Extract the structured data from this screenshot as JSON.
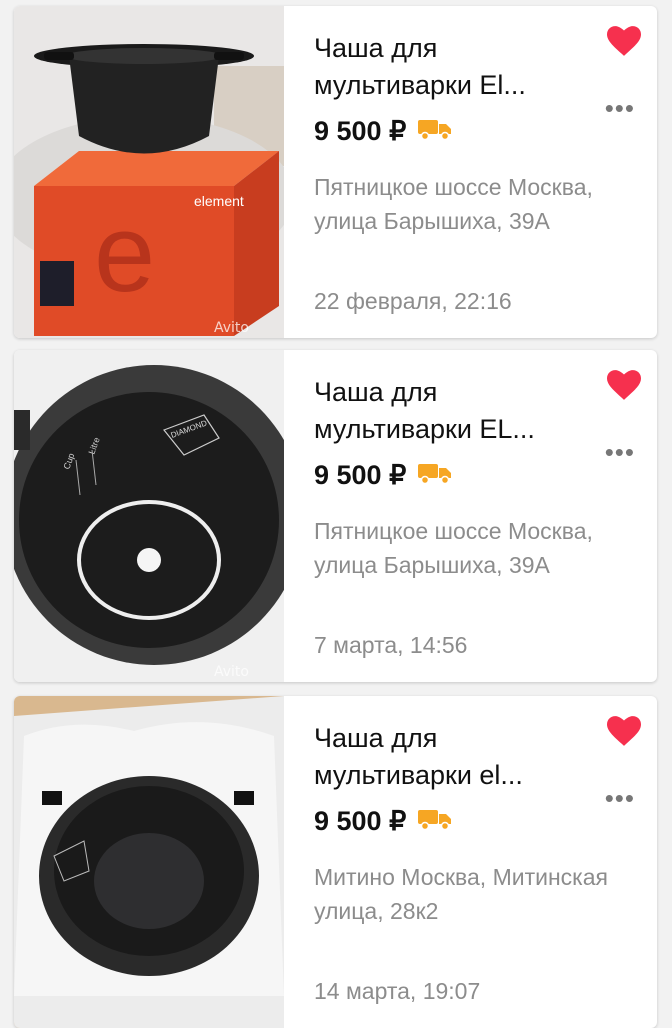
{
  "listings": [
    {
      "title": "Чаша для мультиварки El...",
      "price": "9 500 ₽",
      "address": "Пятницкое шоссе Москва, улица Барышиха, 39А",
      "date": "22 февраля, 22:16",
      "favorited": true,
      "watermark": "Avito",
      "box_label": "element"
    },
    {
      "title": "Чаша для мультиварки EL...",
      "price": "9 500 ₽",
      "address": "Пятницкое шоссе Москва, улица Барышиха, 39А",
      "date": "7 марта, 14:56",
      "favorited": true,
      "watermark": "Avito",
      "pot_labels": [
        "Cup",
        "Litre",
        "DIAMOND"
      ]
    },
    {
      "title": "Чаша для мультиварки el...",
      "price": "9 500 ₽",
      "address": "Митино Москва, Митинская улица, 28к2",
      "date": "14 марта, 19:07",
      "favorited": true
    }
  ],
  "icons": {
    "favorite": "heart-icon",
    "more": "more-dots-icon",
    "delivery": "truck-icon"
  },
  "colors": {
    "heart": "#f6304e",
    "truck": "#f6a623",
    "text": "#111111",
    "muted": "#8c8c8c",
    "box": "#e04b27"
  }
}
